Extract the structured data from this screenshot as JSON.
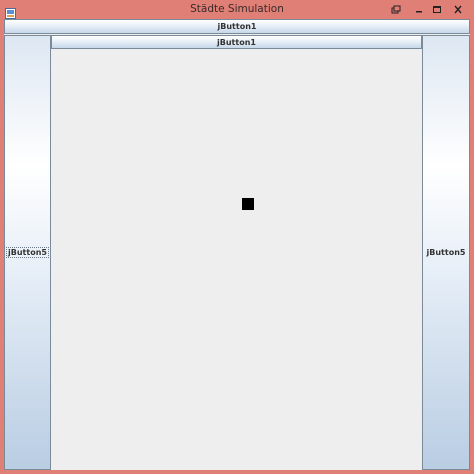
{
  "window": {
    "title": "Städte Simulation",
    "frame_color": "#e07f76",
    "controls": {
      "restore_icon": "restore-icon",
      "minimize_icon": "minimize-icon",
      "maximize_icon": "maximize-icon",
      "close_icon": "close-icon"
    }
  },
  "buttons": {
    "north_label": "jButton1",
    "inner_north_label": "jButton1",
    "west_label": "jButton5",
    "east_label": "jButton5"
  },
  "canvas": {
    "background": "#eeeeee",
    "marker_color": "#000000"
  }
}
